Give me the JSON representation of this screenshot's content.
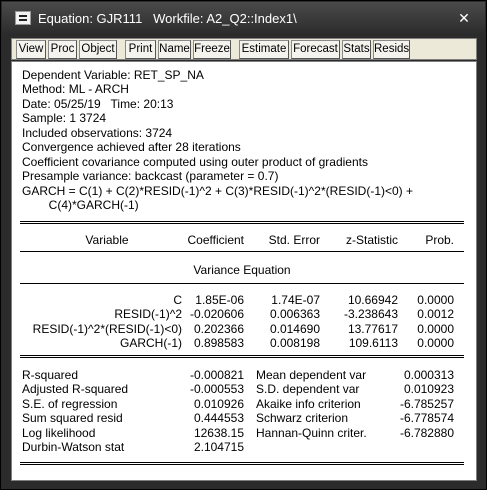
{
  "window": {
    "title": "Equation: GJR111   Workfile: A2_Q2::Index1\\",
    "close_glyph": "✕"
  },
  "toolbar": {
    "buttons": [
      "View",
      "Proc",
      "Object",
      "Print",
      "Name",
      "Freeze",
      "Estimate",
      "Forecast",
      "Stats",
      "Resids"
    ]
  },
  "header": {
    "lines": [
      "Dependent Variable: RET_SP_NA",
      "Method: ML - ARCH",
      "Date: 05/25/19   Time: 20:13",
      "Sample: 1 3724",
      "Included observations: 3724",
      "Convergence achieved after 28 iterations",
      "Coefficient covariance computed using outer product of gradients",
      "Presample variance: backcast (parameter = 0.7)",
      "GARCH = C(1) + C(2)*RESID(-1)^2 + C(3)*RESID(-1)^2*(RESID(-1)<0) +",
      "        C(4)*GARCH(-1)"
    ]
  },
  "coef_table": {
    "columns": [
      "Variable",
      "Coefficient",
      "Std. Error",
      "z-Statistic",
      "Prob."
    ],
    "section": "Variance Equation",
    "rows": [
      {
        "variable": "C",
        "coefficient": "1.85E-06",
        "std_error": "1.74E-07",
        "z_stat": "10.66942",
        "prob": "0.0000"
      },
      {
        "variable": "RESID(-1)^2",
        "coefficient": "-0.020606",
        "std_error": "0.006363",
        "z_stat": "-3.238643",
        "prob": "0.0012"
      },
      {
        "variable": "RESID(-1)^2*(RESID(-1)<0)",
        "coefficient": "0.202366",
        "std_error": "0.014690",
        "z_stat": "13.77617",
        "prob": "0.0000"
      },
      {
        "variable": "GARCH(-1)",
        "coefficient": "0.898583",
        "std_error": "0.008198",
        "z_stat": "109.6113",
        "prob": "0.0000"
      }
    ]
  },
  "stats": {
    "left": [
      {
        "label": "R-squared",
        "value": "-0.000821"
      },
      {
        "label": "Adjusted R-squared",
        "value": "-0.000553"
      },
      {
        "label": "S.E. of regression",
        "value": "0.010926"
      },
      {
        "label": "Sum squared resid",
        "value": "0.444553"
      },
      {
        "label": "Log likelihood",
        "value": "12638.15"
      },
      {
        "label": "Durbin-Watson stat",
        "value": "2.104715"
      }
    ],
    "right": [
      {
        "label": "Mean dependent var",
        "value": "0.000313"
      },
      {
        "label": "S.D. dependent var",
        "value": "0.010923"
      },
      {
        "label": "Akaike info criterion",
        "value": "-6.785257"
      },
      {
        "label": "Schwarz criterion",
        "value": "-6.778574"
      },
      {
        "label": "Hannan-Quinn criter.",
        "value": "-6.782880"
      }
    ]
  }
}
